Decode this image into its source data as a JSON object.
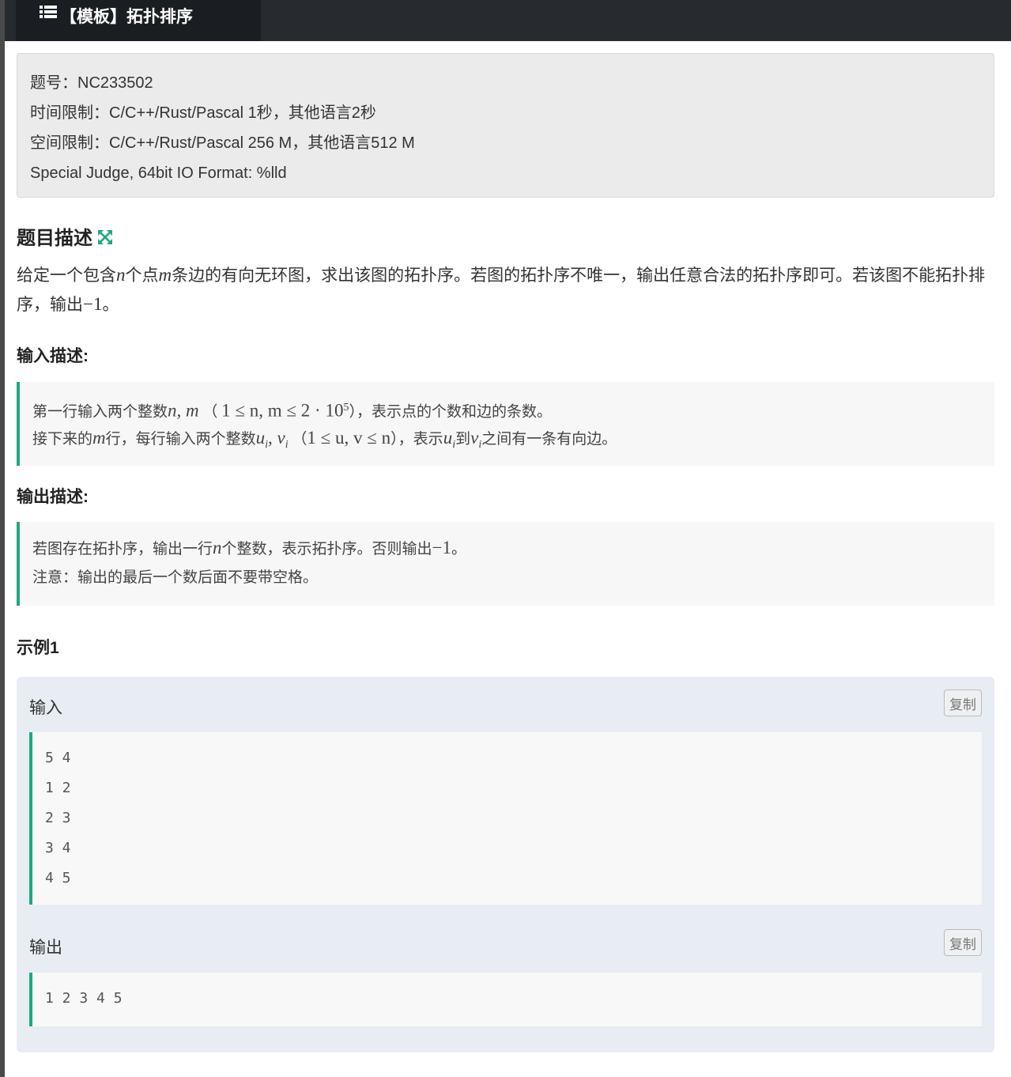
{
  "header": {
    "title": "【模板】拓扑排序",
    "icon": "list-icon"
  },
  "meta": {
    "problem_id": "题号：NC233502",
    "time_limit": "时间限制：C/C++/Rust/Pascal 1秒，其他语言2秒",
    "memory_limit": "空间限制：C/C++/Rust/Pascal 256 M，其他语言512 M",
    "judge": "Special Judge, 64bit IO Format: %lld"
  },
  "description": {
    "heading": "题目描述",
    "text_1": "给定一个包含",
    "var_n": "n",
    "text_2": "个点",
    "var_m": "m",
    "text_3": "条边的有向无环图，求出该图的拓扑序。若图的拓扑序不唯一，输出任意合法的拓扑序即可。若该图不能拓扑排序，输出",
    "neg_one": "−1",
    "text_4": "。"
  },
  "input_desc": {
    "heading": "输入描述:",
    "l1_a": "第一行输入两个整数",
    "l1_math": "n, m",
    "l1_b": " （ ",
    "l1_math2": "1 ≤ n, m ≤ 2 · 10",
    "l1_sup": "5",
    "l1_c": "），表示点的个数和边的条数。",
    "l2_a": "接下来的",
    "l2_m": "m",
    "l2_b": "行，每行输入两个整数",
    "l2_uv": "u",
    "l2_i1": "i",
    "l2_comma": ", ",
    "l2_v": "v",
    "l2_i2": "i",
    "l2_c": " （",
    "l2_range": "1 ≤ u, v ≤ n",
    "l2_d": "），表示",
    "l2_u2": "u",
    "l2_i3": "i",
    "l2_e": "到",
    "l2_v2": "v",
    "l2_i4": "i",
    "l2_f": "之间有一条有向边。"
  },
  "output_desc": {
    "heading": "输出描述:",
    "l1_a": "若图存在拓扑序，输出一行",
    "l1_n": "n",
    "l1_b": "个整数，表示拓扑序。否则输出",
    "l1_neg": "−1",
    "l1_c": "。",
    "l2": "注意：输出的最后一个数后面不要带空格。"
  },
  "example": {
    "heading": "示例1",
    "input_label": "输入",
    "output_label": "输出",
    "copy_label": "复制",
    "input_lines": [
      "5 4",
      "1 2",
      "2 3",
      "3 4",
      "4 5"
    ],
    "output_lines": [
      "1 2 3 4 5"
    ]
  },
  "colors": {
    "accent": "#20a77f",
    "topbar": "#272b30"
  }
}
